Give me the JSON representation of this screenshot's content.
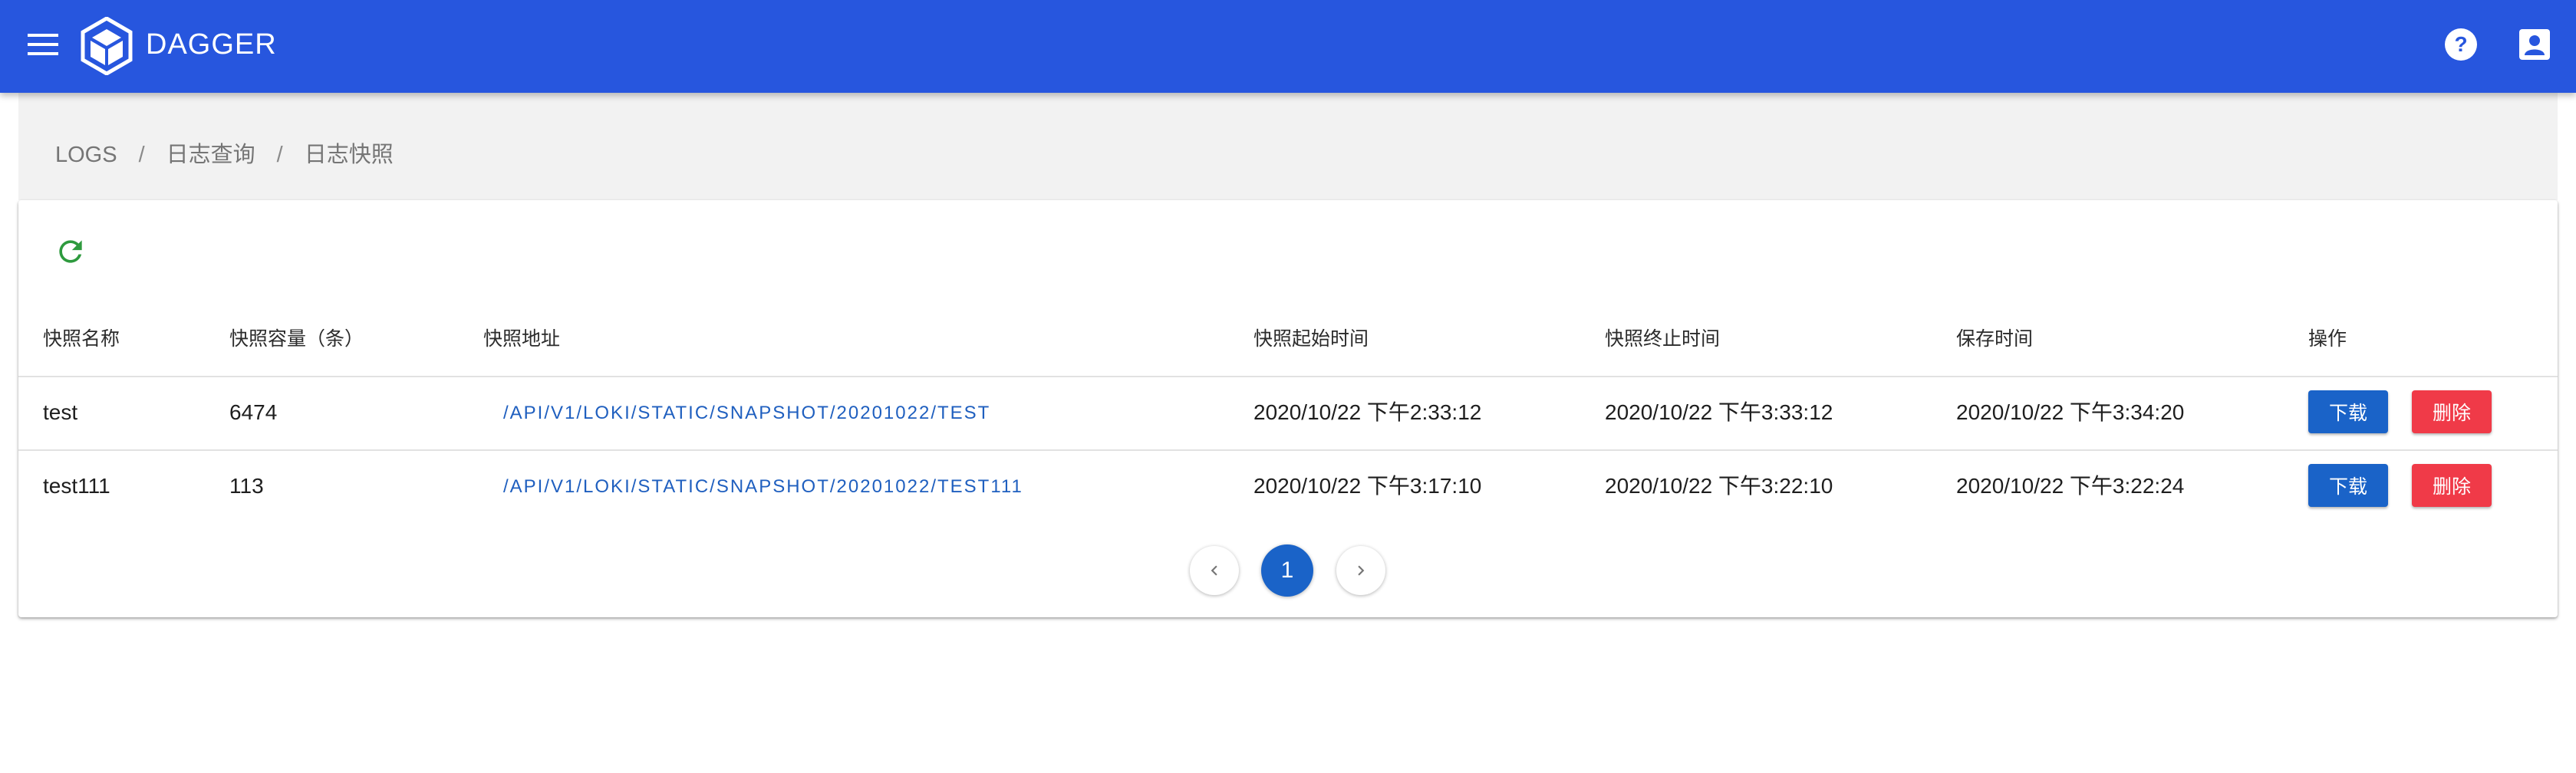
{
  "app": {
    "title": "DAGGER",
    "colors": {
      "primary": "#2756de",
      "link": "#1f5fbf",
      "download": "#1a63c8",
      "delete": "#f03a48",
      "refresh": "#2e9a3e"
    },
    "icons": {
      "menu": "menu-icon",
      "logo": "cube-logo-icon",
      "help": "help-icon",
      "account": "account-box-icon",
      "refresh": "refresh-icon",
      "prev": "chevron-left-icon",
      "next": "chevron-right-icon"
    }
  },
  "breadcrumb": {
    "items": [
      "LOGS",
      "日志查询",
      "日志快照"
    ],
    "separator": "/"
  },
  "table": {
    "headers": [
      "快照名称",
      "快照容量（条）",
      "快照地址",
      "快照起始时间",
      "快照终止时间",
      "保存时间",
      "操作"
    ],
    "rows": [
      {
        "name": "test",
        "capacity": "6474",
        "address": "/API/V1/LOKI/STATIC/SNAPSHOT/20201022/TEST",
        "start_time": "2020/10/22 下午2:33:12",
        "end_time": "2020/10/22 下午3:33:12",
        "saved_time": "2020/10/22 下午3:34:20",
        "download_label": "下载",
        "delete_label": "删除"
      },
      {
        "name": "test111",
        "capacity": "113",
        "address": "/API/V1/LOKI/STATIC/SNAPSHOT/20201022/TEST111",
        "start_time": "2020/10/22 下午3:17:10",
        "end_time": "2020/10/22 下午3:22:10",
        "saved_time": "2020/10/22 下午3:22:24",
        "download_label": "下载",
        "delete_label": "删除"
      }
    ]
  },
  "pagination": {
    "current_page": "1"
  }
}
